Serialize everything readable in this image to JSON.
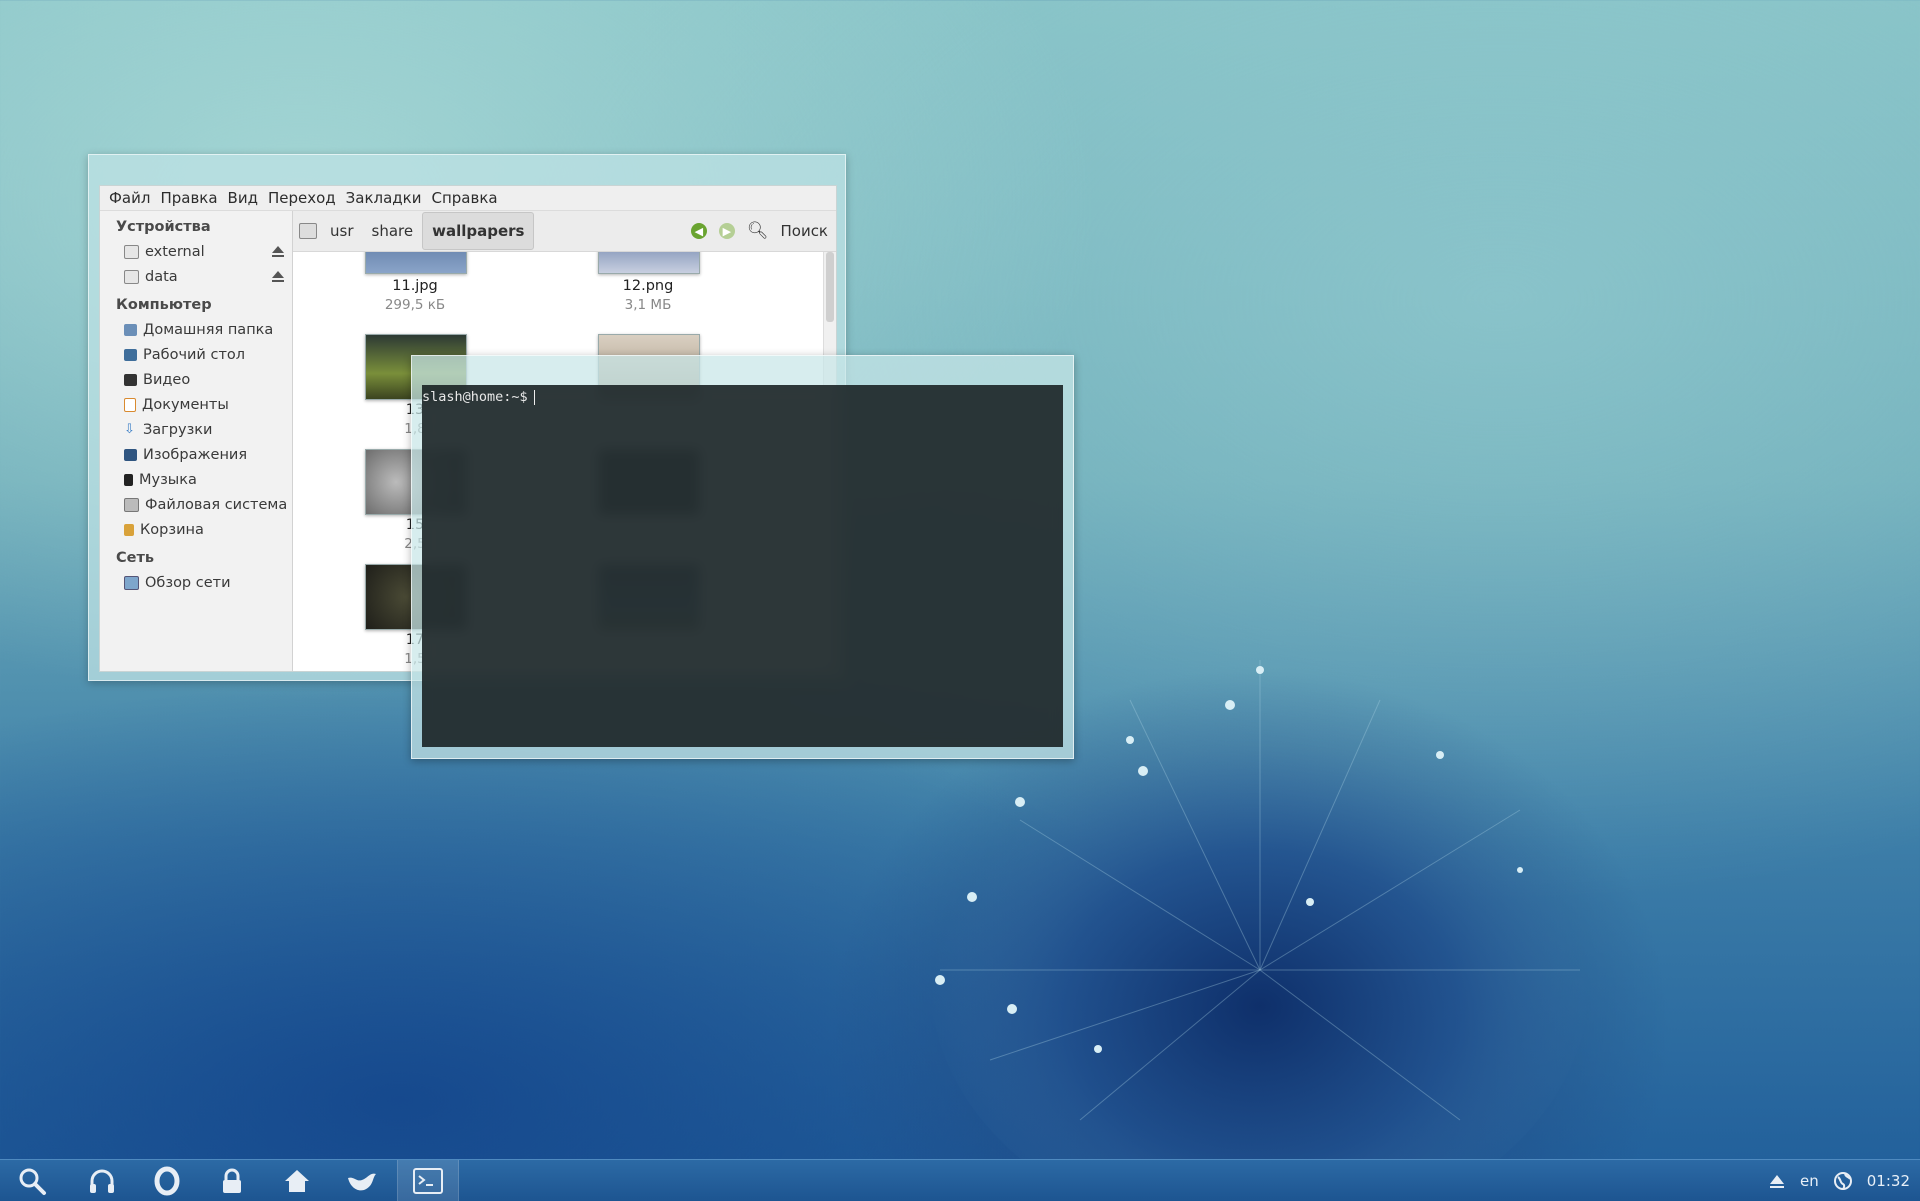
{
  "file_manager": {
    "menu": [
      "Файл",
      "Правка",
      "Вид",
      "Переход",
      "Закладки",
      "Справка"
    ],
    "sidebar": {
      "devices_title": "Устройства",
      "devices": [
        "external",
        "data"
      ],
      "computer_title": "Компьютер",
      "computer": [
        "Домашняя папка",
        "Рабочий стол",
        "Видео",
        "Документы",
        "Загрузки",
        "Изображения",
        "Музыка",
        "Файловая система",
        "Корзина"
      ],
      "network_title": "Сеть",
      "network": [
        "Обзор сети"
      ]
    },
    "path": [
      "usr",
      "share",
      "wallpapers"
    ],
    "search_label": "Поиск",
    "files": [
      {
        "name": "11.jpg",
        "size": "299,5 кБ"
      },
      {
        "name": "12.png",
        "size": "3,1 МБ"
      },
      {
        "name": "13",
        "size": "1,8"
      },
      {
        "name": "15",
        "size": "2,5"
      },
      {
        "name": "17",
        "size": "1,5"
      }
    ]
  },
  "terminal": {
    "prompt": "slash@home:~$"
  },
  "taskbar": {
    "language": "en",
    "clock": "01:32"
  },
  "colors": {
    "taskbar": "#1d5591",
    "back_arrow": "#6aa431"
  }
}
